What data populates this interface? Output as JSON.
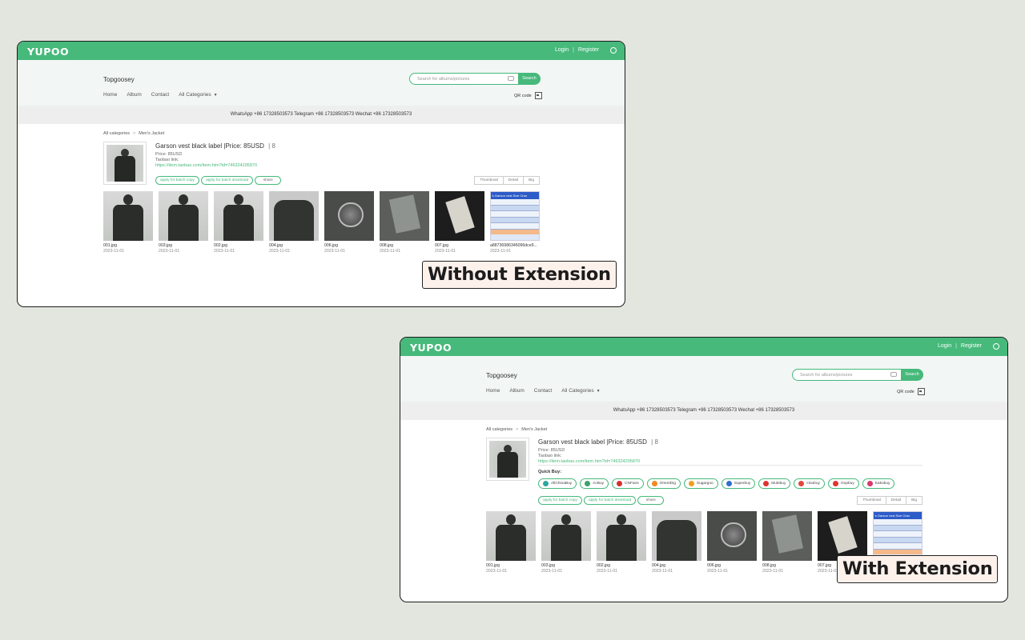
{
  "site": {
    "logo": "YUPOO",
    "login": "Login",
    "register": "Register",
    "shop_name": "Topgoosey",
    "nav": [
      "Home",
      "Album",
      "Contact",
      "All Categories"
    ],
    "search_placeholder": "Search for albums/pictures",
    "search_button": "Search",
    "qr_code": "QR code",
    "contact_line": "WhatsApp +86 17328503573  Telegram +86 17328503573  Wechat +86 17328503573",
    "breadcrumb": [
      "All categories",
      "Men's Jacket"
    ]
  },
  "album": {
    "title": "Garson vest black label |Price: 85USD",
    "count": "8",
    "price": "Price: 85USD",
    "taobao_label": "Taobao link:",
    "taobao_url": "https://item.taobao.com/item.htm?id=746324295870",
    "actions": [
      "apply for batch copy",
      "apply for batch download",
      "share"
    ],
    "views": [
      "Thumbnail",
      "Detail",
      "Big"
    ]
  },
  "photos": [
    {
      "name": "001.jpg",
      "date": "2023-11-01",
      "kind": "body"
    },
    {
      "name": "003.jpg",
      "date": "2023-11-01",
      "kind": "body"
    },
    {
      "name": "002.jpg",
      "date": "2023-11-01",
      "kind": "body"
    },
    {
      "name": "004.jpg",
      "date": "2023-11-01",
      "kind": "back"
    },
    {
      "name": "006.jpg",
      "date": "2023-11-01",
      "kind": "badge"
    },
    {
      "name": "008.jpg",
      "date": "2023-11-01",
      "kind": "tag"
    },
    {
      "name": "007.jpg",
      "date": "2023-11-01",
      "kind": "label"
    },
    {
      "name": "a88736986346096dce9...",
      "date": "2023-11-01",
      "kind": "chart"
    }
  ],
  "size_chart_header": "'s Garson vest Size Char",
  "quick_buy": {
    "label": "Quick Buy:",
    "agents": [
      {
        "name": "AllChinaBuy",
        "color": "#2aa7a0"
      },
      {
        "name": "AcBuy",
        "color": "#3aa36a"
      },
      {
        "name": "CNFans",
        "color": "#d9302c"
      },
      {
        "name": "OrientDig",
        "color": "#f08a24"
      },
      {
        "name": "Sugargoo",
        "color": "#f0a020"
      },
      {
        "name": "Superbuy",
        "color": "#2f6fd0"
      },
      {
        "name": "Mulebuy",
        "color": "#e0342f"
      },
      {
        "name": "Hoobuy",
        "color": "#e04a3c"
      },
      {
        "name": "Oopbuy",
        "color": "#e0342f"
      },
      {
        "name": "Kakobuy",
        "color": "#d93a6a"
      }
    ]
  },
  "badges": {
    "without": "Without Extension",
    "with": "With Extension"
  },
  "colors": {
    "brand_green": "#46b97b",
    "background": "#e3e6de",
    "badge_bg": "#fdf1ec"
  }
}
